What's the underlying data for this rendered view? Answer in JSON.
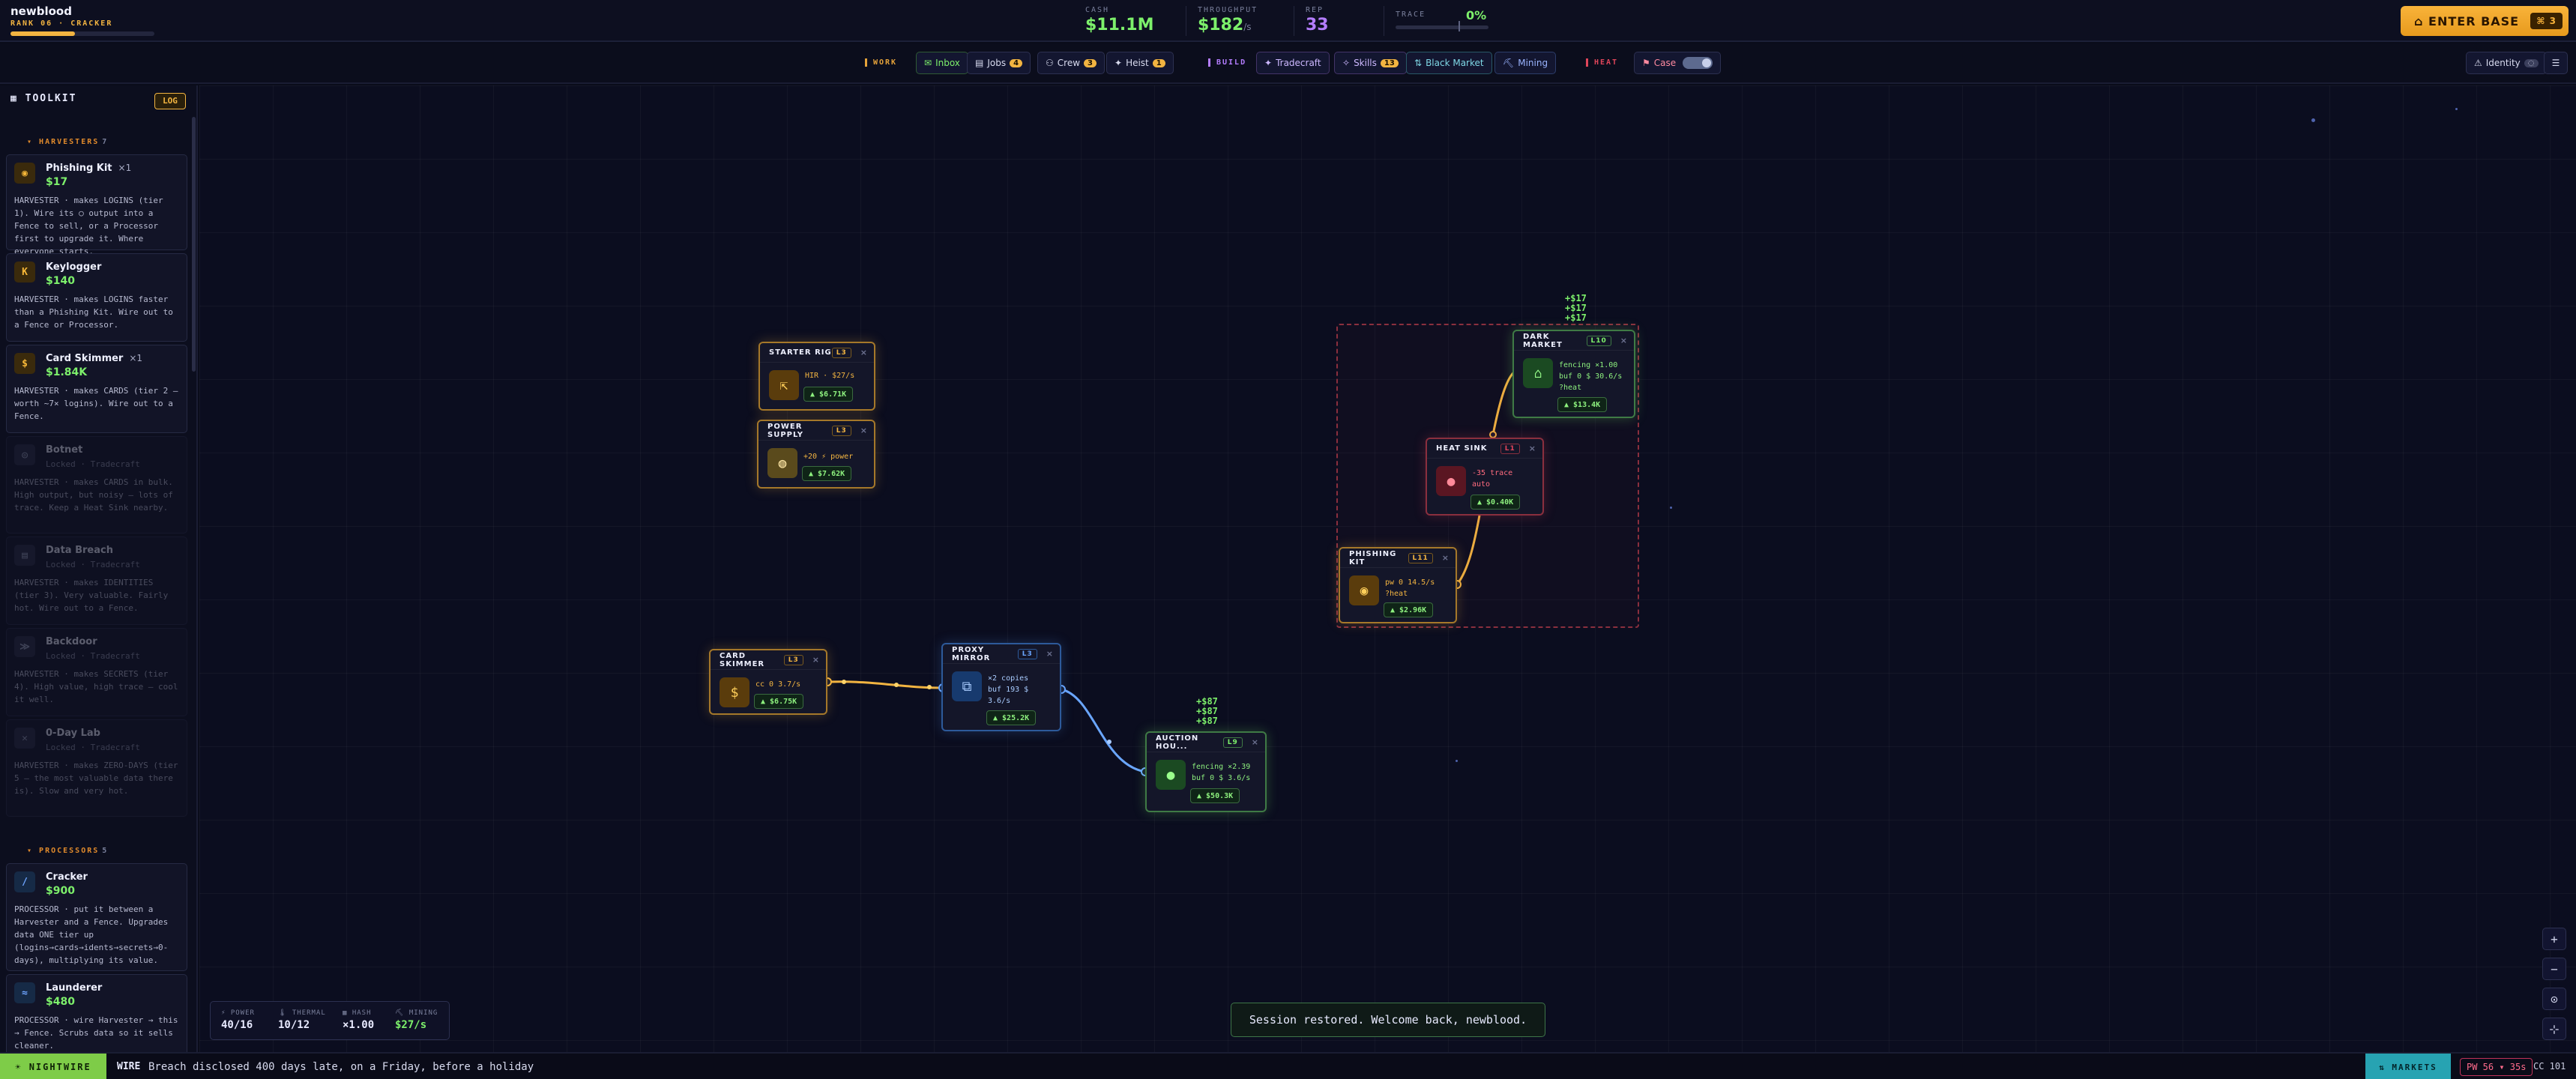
{
  "player": {
    "name": "newblood",
    "rank": "RANK 06 · CRACKER",
    "rank_progress": 0.45
  },
  "stats": {
    "cash": {
      "label": "CASH",
      "value": "$11.1M"
    },
    "throughput": {
      "label": "THROUGHPUT",
      "value": "$182",
      "unit": "/s"
    },
    "rep": {
      "label": "REP",
      "value": "33"
    },
    "trace": {
      "label": "TRACE",
      "value": "0%"
    }
  },
  "enter_base": {
    "label": "⌂ ENTER BASE",
    "shortcut": "⌘ 3"
  },
  "nav": {
    "work_label": "WORK",
    "inbox": "Inbox",
    "jobs": "Jobs",
    "jobs_badge": "4",
    "crew": "Crew",
    "crew_badge": "3",
    "heist": "Heist",
    "heist_badge": "1",
    "build_label": "BUILD",
    "tradecraft": "Tradecraft",
    "skills": "Skills",
    "skills_badge": "13",
    "black_market": "Black Market",
    "mining": "Mining",
    "heat_label": "HEAT",
    "case": "Case",
    "identity": "Identity"
  },
  "sidebar": {
    "title": "TOOLKIT",
    "log": "LOG",
    "harvesters_label": "HARVESTERS",
    "harvesters_count": "7",
    "processors_label": "PROCESSORS",
    "processors_count": "5",
    "cards": [
      {
        "name": "Phishing Kit",
        "owned": "×1",
        "price": "$17",
        "icon": "◉",
        "desc": "HARVESTER · makes LOGINS (tier 1). Wire its ○ output into a Fence to sell, or a Processor first to upgrade it. Where everyone starts."
      },
      {
        "name": "Keylogger",
        "price": "$140",
        "icon": "K",
        "desc": "HARVESTER · makes LOGINS faster than a Phishing Kit. Wire out to a Fence or Processor."
      },
      {
        "name": "Card Skimmer",
        "owned": "×1",
        "price": "$1.84K",
        "icon": "$",
        "desc": "HARVESTER · makes CARDS (tier 2 — worth ~7× logins). Wire out to a Fence."
      },
      {
        "name": "Botnet",
        "lock": "Locked · Tradecraft",
        "icon": "◎",
        "desc": "HARVESTER · makes CARDS in bulk. High output, but noisy — lots of trace. Keep a Heat Sink nearby."
      },
      {
        "name": "Data Breach",
        "lock": "Locked · Tradecraft",
        "icon": "▤",
        "desc": "HARVESTER · makes IDENTITIES (tier 3). Very valuable. Fairly hot. Wire out to a Fence."
      },
      {
        "name": "Backdoor",
        "lock": "Locked · Tradecraft",
        "icon": "≫",
        "desc": "HARVESTER · makes SECRETS (tier 4). High value, high trace — cool it well."
      },
      {
        "name": "0-Day Lab",
        "lock": "Locked · Tradecraft",
        "icon": "✕",
        "desc": "HARVESTER · makes ZERO-DAYS (tier 5 — the most valuable data there is). Slow and very hot."
      },
      {
        "name": "Cracker",
        "price": "$900",
        "icon": "/",
        "desc": "PROCESSOR · put it between a Harvester and a Fence. Upgrades data ONE tier up (logins→cards→idents→secrets→0-days), multiplying its value."
      },
      {
        "name": "Launderer",
        "price": "$480",
        "icon": "≈",
        "desc": "PROCESSOR · wire Harvester → this → Fence. Scrubs data so it sells cleaner."
      }
    ]
  },
  "nodes": {
    "starter_rig": {
      "title": "STARTER RIG",
      "level": "L3",
      "line1": "HIR · $27/s",
      "chip": "▲ $6.71K"
    },
    "power_supply": {
      "title": "POWER SUPPLY",
      "level": "L3",
      "line1": "+20 ⚡ power",
      "chip": "▲ $7.62K"
    },
    "card_skimmer": {
      "title": "CARD SKIMMER",
      "level": "L3",
      "line1": "cc 0 3.7/s",
      "chip": "▲ $6.75K"
    },
    "proxy_mirror": {
      "title": "PROXY MIRROR",
      "level": "L3",
      "line1": "×2 copies",
      "line2": "buf 193 $",
      "line3": "3.6/s",
      "chip": "▲ $25.2K"
    },
    "auction_house": {
      "title": "AUCTION HOU...",
      "level": "L9",
      "line1": "fencing ×2.39",
      "line2": "buf 0 $ 3.6/s",
      "chip": "▲ $50.3K"
    },
    "phishing_kit": {
      "title": "PHISHING KIT",
      "level": "L11",
      "line1": "pw 0 14.5/s",
      "line2": "?heat",
      "chip": "▲ $2.96K"
    },
    "heat_sink": {
      "title": "HEAT SINK",
      "level": "L1",
      "line1": "-35 trace",
      "line2": "auto",
      "chip": "▲ $0.40K"
    },
    "dark_market": {
      "title": "DARK MARKET",
      "level": "L10",
      "line1": "fencing ×1.00",
      "line2": "buf 0 $ 30.6/s",
      "line3": "?heat",
      "chip": "▲ $13.4K"
    }
  },
  "floats": {
    "auction": [
      "+$87",
      "+$87",
      "+$87"
    ],
    "dark_market": [
      "+$17",
      "+$17",
      "+$17"
    ]
  },
  "hud": {
    "power_label": "⚡ POWER",
    "power": "40/16",
    "thermal_label": "🌡 THERMAL",
    "thermal": "10/12",
    "hash_label": "▦ HASH",
    "hash": "×1.00",
    "mining_label": "⛏ MINING",
    "mining": "$27/s"
  },
  "toast": "Session restored. Welcome back, newblood.",
  "zoom": {
    "in": "+",
    "out": "−",
    "center": "⊙",
    "fit": "⊹"
  },
  "bottom": {
    "phase": "☀ NIGHTWIRE",
    "wire_label": "WIRE",
    "ticker": "Breach disclosed 400 days late, on a Friday, before a holiday",
    "markets": "⇅ MARKETS",
    "price": "PW 56 ▾ 35s",
    "cc": "CC 101"
  },
  "colors": {
    "accent": "#f2b441",
    "green": "#7df06b",
    "heat": "#e0455a",
    "blue": "#4d8ae8",
    "purple": "#b47dff"
  }
}
